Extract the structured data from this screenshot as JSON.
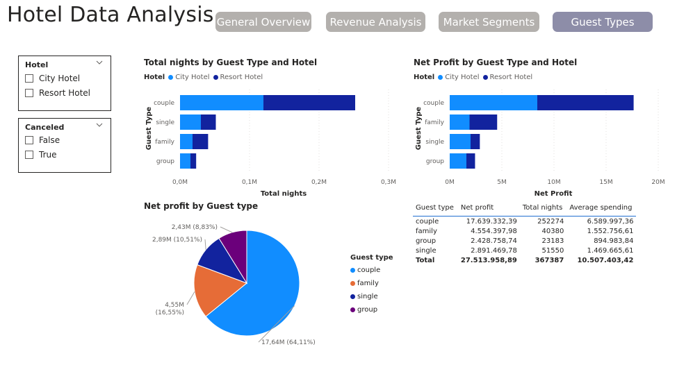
{
  "header": {
    "title": "Hotel Data Analysis",
    "tabs": [
      {
        "label": "General Overview",
        "active": false
      },
      {
        "label": "Revenue Analysis",
        "active": false
      },
      {
        "label": "Market Segments",
        "active": false
      },
      {
        "label": "Guest Types",
        "active": true
      }
    ]
  },
  "slicers": {
    "hotel": {
      "label": "Hotel",
      "options": [
        "City Hotel",
        "Resort Hotel"
      ]
    },
    "canceled": {
      "label": "Canceled",
      "options": [
        "False",
        "True"
      ]
    }
  },
  "colors": {
    "city": "#118dff",
    "resort": "#12239e",
    "couple": "#118dff",
    "family": "#e66c37",
    "single": "#12239e",
    "group": "#6b007b",
    "tab_inactive": "#b3b0ad",
    "tab_active": "#8d8da8"
  },
  "chart_data": [
    {
      "type": "bar",
      "orientation": "horizontal",
      "stacked": true,
      "title": "Total nights by Guest Type and Hotel",
      "legend_title": "Hotel",
      "ylabel": "Guest Type",
      "xlabel": "Total nights",
      "categories": [
        "couple",
        "single",
        "family",
        "group"
      ],
      "series": [
        {
          "name": "City Hotel",
          "values": [
            120000,
            30000,
            18000,
            15000
          ]
        },
        {
          "name": "Resort Hotel",
          "values": [
            132000,
            21500,
            22400,
            8200
          ]
        }
      ],
      "xlim": [
        0,
        300000
      ],
      "xticks": [
        0,
        100000,
        200000,
        300000
      ],
      "xtick_labels": [
        "0,0M",
        "0,1M",
        "0,2M",
        "0,3M"
      ],
      "grid": true
    },
    {
      "type": "bar",
      "orientation": "horizontal",
      "stacked": true,
      "title": "Net Profit by Guest Type and Hotel",
      "legend_title": "Hotel",
      "ylabel": "Guest Type",
      "xlabel": "Net Profit",
      "categories": [
        "couple",
        "family",
        "single",
        "group"
      ],
      "series": [
        {
          "name": "City Hotel",
          "values": [
            8400000,
            1900000,
            2000000,
            1600000
          ]
        },
        {
          "name": "Resort Hotel",
          "values": [
            9240000,
            2650000,
            890000,
            830000
          ]
        }
      ],
      "xlim": [
        0,
        20000000
      ],
      "xticks": [
        0,
        5000000,
        10000000,
        15000000,
        20000000
      ],
      "xtick_labels": [
        "0M",
        "5M",
        "10M",
        "15M",
        "20M"
      ],
      "grid": true
    },
    {
      "type": "pie",
      "title": "Net profit by Guest type",
      "legend_title": "Guest type",
      "slices": [
        {
          "name": "couple",
          "value": 17639332.39,
          "label_line1": "17,64M (64,11%)",
          "label_line2": ""
        },
        {
          "name": "family",
          "value": 4554397.98,
          "label_line1": "4,55M",
          "label_line2": "(16,55%)"
        },
        {
          "name": "single",
          "value": 2891469.78,
          "label_line1": "2,89M (10,51%)",
          "label_line2": ""
        },
        {
          "name": "group",
          "value": 2428758.74,
          "label_line1": "2,43M (8,83%)",
          "label_line2": ""
        }
      ]
    },
    {
      "type": "table",
      "columns": [
        "Guest type",
        "Net profit",
        "Total nights",
        "Average spending"
      ],
      "rows": [
        [
          "couple",
          "17.639.332,39",
          "252274",
          "6.589.997,36"
        ],
        [
          "family",
          "4.554.397,98",
          "40380",
          "1.552.756,61"
        ],
        [
          "group",
          "2.428.758,74",
          "23183",
          "894.983,84"
        ],
        [
          "single",
          "2.891.469,78",
          "51550",
          "1.469.665,61"
        ]
      ],
      "total": [
        "Total",
        "27.513.958,89",
        "367387",
        "10.507.403,42"
      ]
    }
  ]
}
